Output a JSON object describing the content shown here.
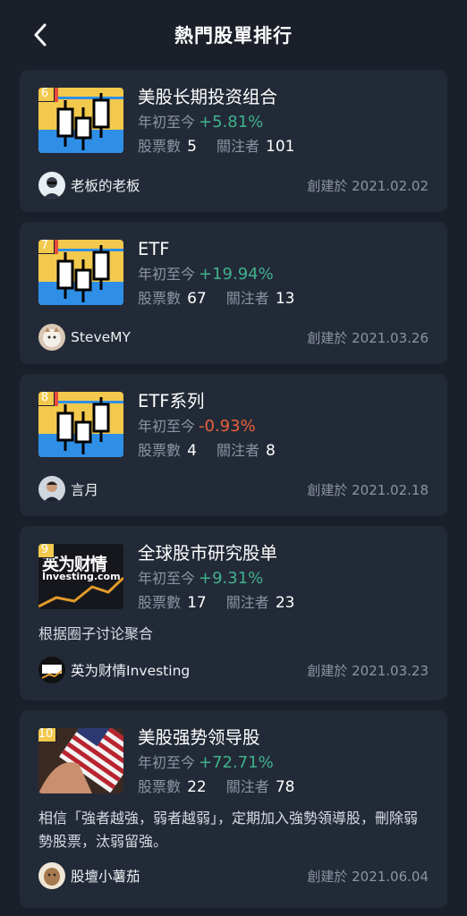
{
  "header": {
    "title": "熱門股單排行",
    "back_icon": "chevron-left-icon"
  },
  "labels": {
    "ytd": "年初至今",
    "stocks": "股票數",
    "followers": "關注者"
  },
  "colors": {
    "positive": "#3fb28c",
    "negative": "#e8603c",
    "card": "#232a37",
    "background": "#1a1f2a"
  },
  "cards": [
    {
      "rank": "6",
      "name": "美股长期投资组合",
      "ytd": "+5.81%",
      "stocks": "5",
      "followers": "101",
      "owner": "老板的老板",
      "created": "創建於 2021.02.02"
    },
    {
      "rank": "7",
      "name": "ETF",
      "ytd": "+19.94%",
      "stocks": "67",
      "followers": "13",
      "owner": "SteveMY",
      "created": "創建於 2021.03.26"
    },
    {
      "rank": "8",
      "name": "ETF系列",
      "ytd": "-0.93%",
      "stocks": "4",
      "followers": "8",
      "owner": "言月",
      "created": "創建於 2021.02.18"
    },
    {
      "rank": "9",
      "name": "全球股市研究股单",
      "ytd": "+9.31%",
      "stocks": "17",
      "followers": "23",
      "description": "根据圈子讨论聚合",
      "owner": "英为财情Investing",
      "created": "創建於 2021.03.23",
      "thumb_text": "英为财情",
      "thumb_sub": "Investing.com"
    },
    {
      "rank": "10",
      "name": "美股强势领导股",
      "ytd": "+72.71%",
      "stocks": "22",
      "followers": "78",
      "description": "相信「強者越強，弱者越弱」，定期加入強勢領導股，刪除弱勢股票，汰弱留強。",
      "owner": "股壇小薯茄",
      "created": "創建於 2021.06.04"
    }
  ]
}
